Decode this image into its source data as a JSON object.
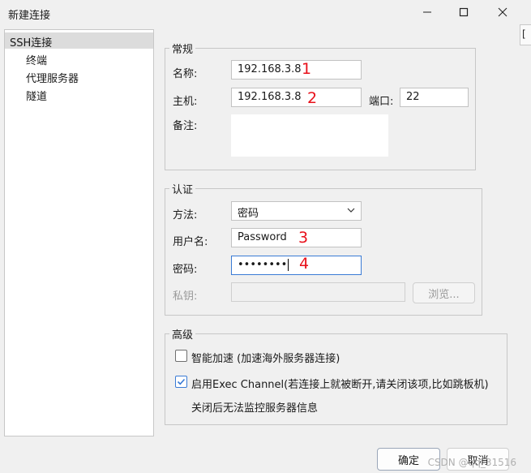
{
  "window": {
    "title": "新建连接"
  },
  "background_tab": {
    "label": "["
  },
  "tree": {
    "items": [
      {
        "label": "SSH连接",
        "selected": true
      },
      {
        "label": "终端"
      },
      {
        "label": "代理服务器"
      },
      {
        "label": "隧道"
      }
    ]
  },
  "general": {
    "legend": "常规",
    "name_label": "名称:",
    "name_value": "192.168.3.8",
    "host_label": "主机:",
    "host_value": "192.168.3.8",
    "port_label": "端口:",
    "port_value": "22",
    "note_label": "备注:",
    "note_value": ""
  },
  "auth": {
    "legend": "认证",
    "method_label": "方法:",
    "method_value": "密码",
    "username_label": "用户名:",
    "username_value": "Password",
    "password_label": "密码:",
    "password_value": "••••••••",
    "key_label": "私钥:",
    "key_value": "",
    "browse_label": "浏览..."
  },
  "advanced": {
    "legend": "高级",
    "smart_accel_label": "智能加速 (加速海外服务器连接)",
    "smart_accel_checked": false,
    "exec_channel_label": "启用Exec Channel(若连接上就被断开,请关闭该项,比如跳板机)",
    "exec_channel_checked": true,
    "exec_channel_note": "关闭后无法监控服务器信息"
  },
  "annotations": [
    "1",
    "2",
    "3",
    "4"
  ],
  "footer": {
    "ok_label": "确定",
    "cancel_label": "取消"
  },
  "watermark": "CSDN @qq_31516",
  "colors": {
    "accent": "#3a7bd5",
    "annotation": "#e8101a"
  }
}
